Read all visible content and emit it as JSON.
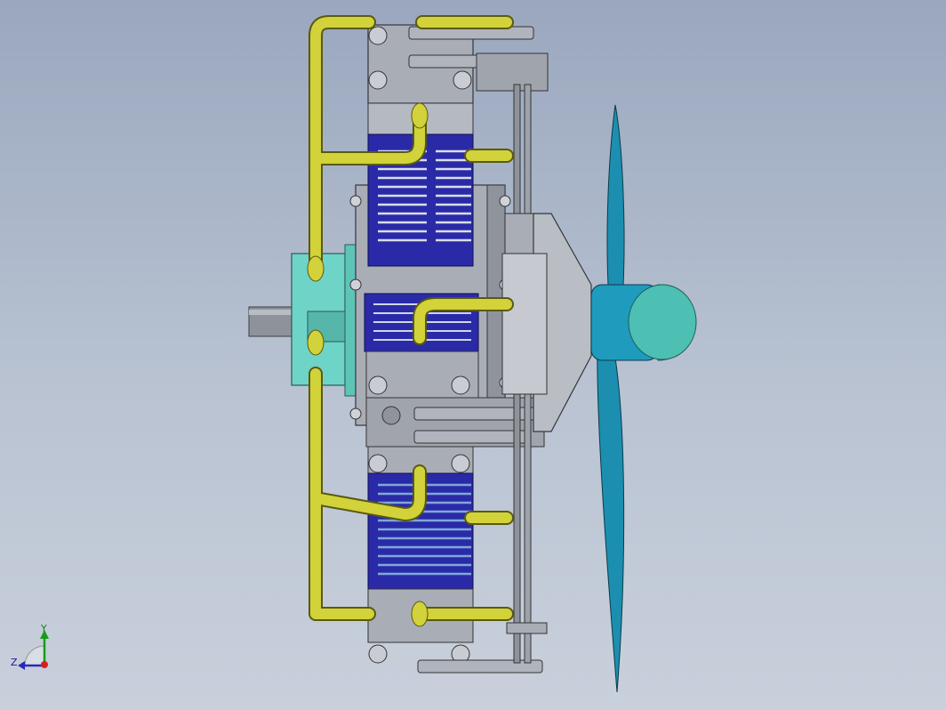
{
  "viewport": {
    "background_top": "#9aa7be",
    "background_bottom": "#c9d0dc"
  },
  "model": {
    "colors": {
      "fuel_line": "#d2d23a",
      "fuel_line_edge": "#5a5a10",
      "cylinder_fins": "#2a2aa8",
      "cylinder_fins_light": "#7fa8d8",
      "cooling_block": "#6fd4c8",
      "metal": "#a9adb6",
      "metal_dark": "#7c808a",
      "propeller": "#1c8fb0",
      "spinner": "#4dbfb3",
      "shaft": "#8e939b"
    },
    "parts": [
      "cylinder-top",
      "cylinder-middle",
      "cylinder-bottom",
      "crankcase",
      "cooling-block",
      "output-shaft",
      "nose-cone",
      "propeller",
      "spinner",
      "push-rods",
      "fuel-lines"
    ]
  },
  "triad": {
    "x_label": "",
    "y_label": "Y",
    "z_label": "Z",
    "icon": "coordinate-triad-icon"
  }
}
